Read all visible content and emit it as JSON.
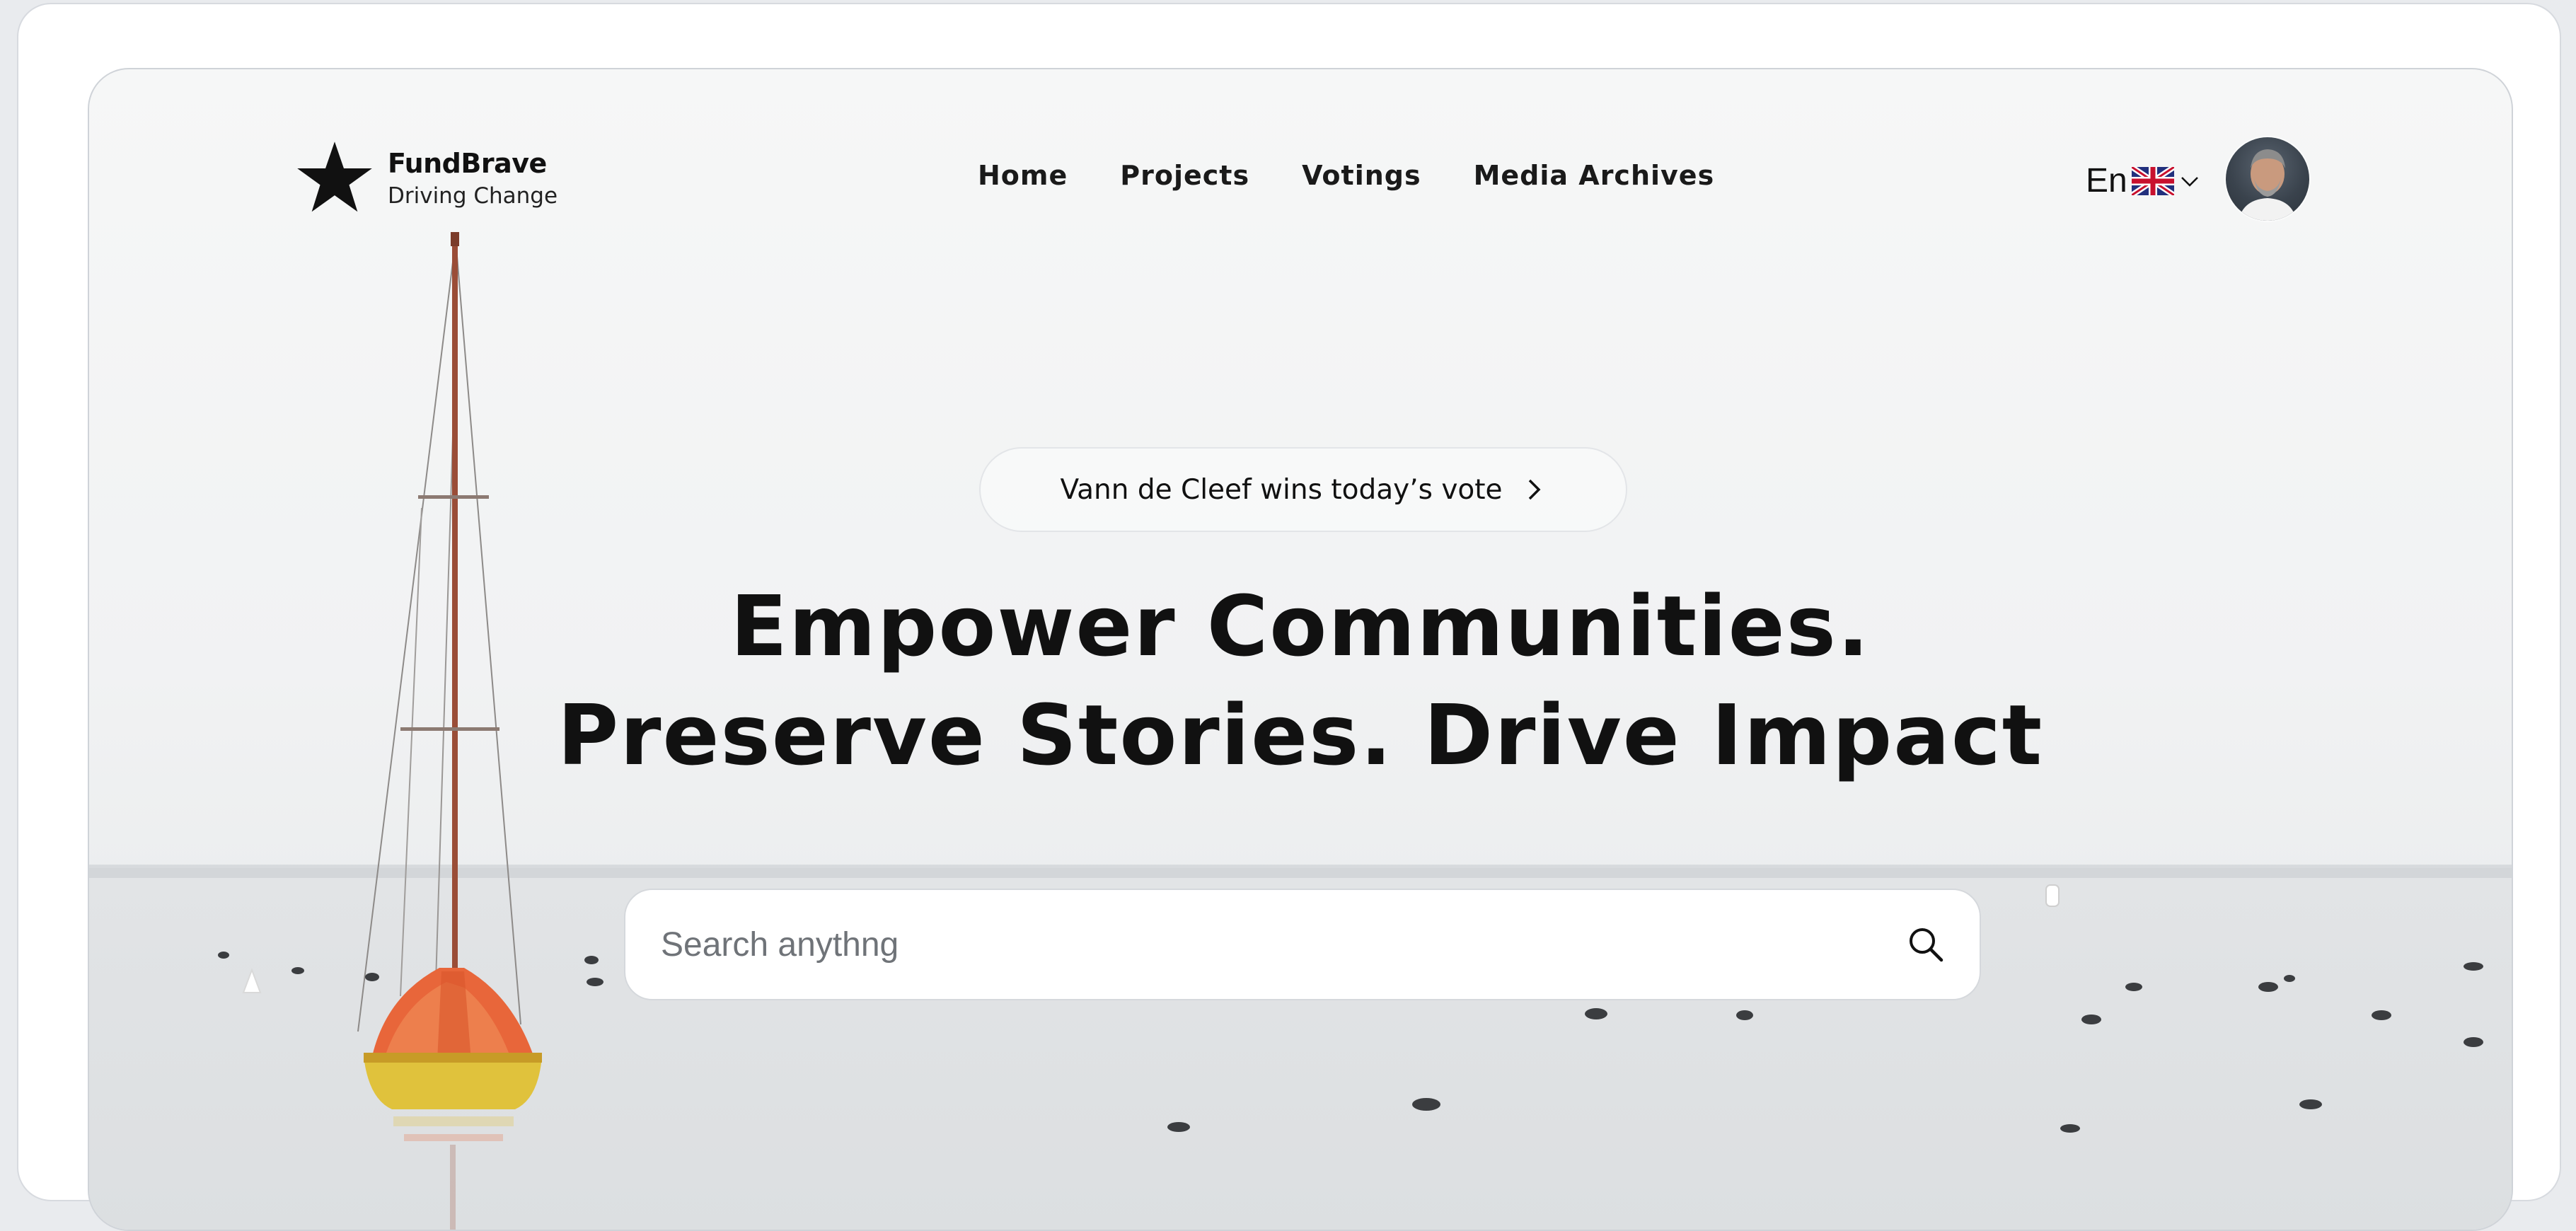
{
  "brand": {
    "name": "FundBrave",
    "tagline": "Driving Change",
    "logo_icon": "star-icon"
  },
  "nav": {
    "items": [
      {
        "label": "Home"
      },
      {
        "label": "Projects"
      },
      {
        "label": "Votings"
      },
      {
        "label": "Media Archives"
      }
    ]
  },
  "language": {
    "code": "En",
    "flag_icon": "uk-flag-icon",
    "dropdown_icon": "chevron-down-icon"
  },
  "user": {
    "avatar": "user-avatar"
  },
  "announcement": {
    "text": "Vann de Cleef wins today’s vote",
    "icon": "chevron-right-icon"
  },
  "hero": {
    "headline_line1": "Empower Communities.",
    "headline_line2": "Preserve Stories. Drive Impact"
  },
  "search": {
    "placeholder": "Search anythng",
    "value": "",
    "icon": "search-icon"
  },
  "colors": {
    "text_dark": "#111111",
    "sail_orange": "#e8663a",
    "hull_yellow": "#e0c23c",
    "background_sky": "#f3f4f4"
  }
}
